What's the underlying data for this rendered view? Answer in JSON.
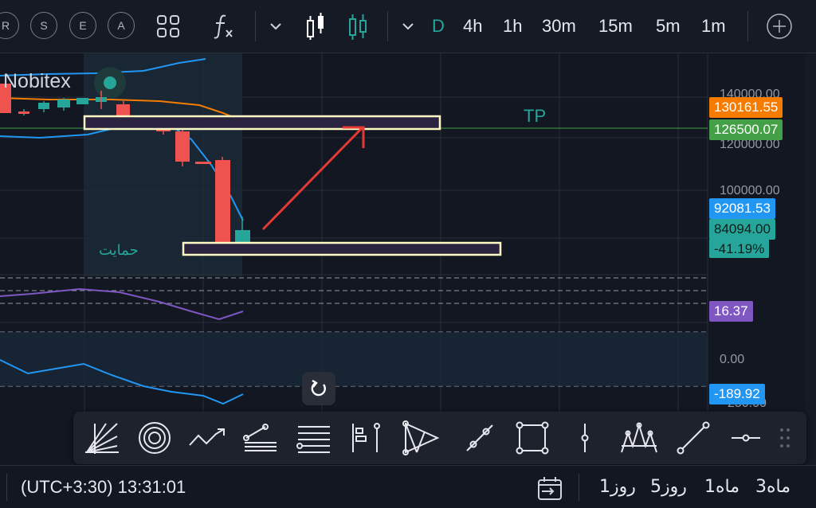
{
  "toolbar": {
    "left_buttons": [
      "R",
      "S",
      "E",
      "A"
    ],
    "timeframes": [
      "D",
      "4h",
      "1h",
      "30m",
      "15m",
      "5m",
      "1m"
    ],
    "active_timeframe": "D",
    "icons": [
      "layouts-grid-icon",
      "function-fx-icon",
      "chevron-down-icon",
      "bar-chart-icon",
      "candlestick-icon",
      "chevron-down-icon",
      "add-icon"
    ]
  },
  "chart": {
    "watermark": "Nobitex",
    "tp_label": "TP",
    "support_label": "حمایت",
    "axis_ticks": [
      "140000.00",
      "120000.00",
      "100000.00",
      "0.00",
      "250.00"
    ],
    "price_labels": [
      {
        "text": "130161.55",
        "color": "#f57c00"
      },
      {
        "text": "126500.07",
        "color": "#43a047"
      },
      {
        "text": "92081.53",
        "color": "#2196f3"
      },
      {
        "text": "84094.00",
        "color": "#26a69a"
      },
      {
        "text": "-41.19%",
        "color": "#26a69a"
      },
      {
        "text": "16.37",
        "color": "#7e57c2"
      },
      {
        "text": "-189.92",
        "color": "#2196f3"
      }
    ]
  },
  "drawing_tools": [
    "pitchfan-icon",
    "ellipse-icon",
    "trend-path-icon",
    "fib-channel-icon",
    "horizontal-lines-icon",
    "measure-icon",
    "pattern-icon",
    "parallel-line-icon",
    "rectangle-icon",
    "vertical-line-icon",
    "head-shoulders-icon",
    "trend-line-icon",
    "horizontal-ray-icon",
    "drag-handle-icon"
  ],
  "footer": {
    "timezone": "(UTC+3:30) 13:31:01",
    "ranges": [
      "1روز",
      "5روز",
      "1ماه",
      "3ماه"
    ],
    "goto_date_icon": "calendar-goto-icon"
  }
}
